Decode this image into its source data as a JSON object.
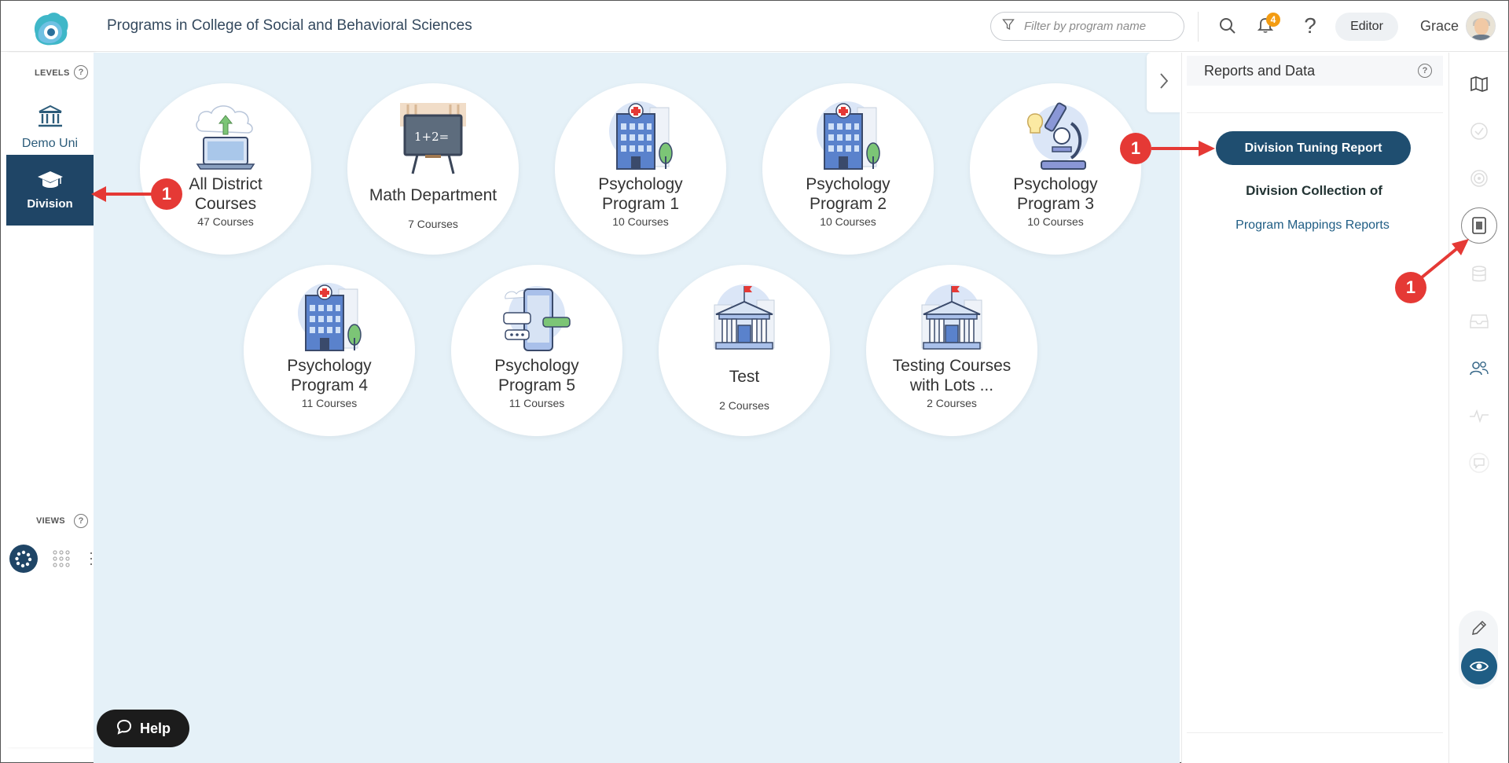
{
  "header": {
    "title": "Programs in College of Social and Behavioral Sciences",
    "filter_placeholder": "Filter by program name",
    "notification_count": "4",
    "help_label": "?",
    "editor_label": "Editor",
    "user_name": "Grace"
  },
  "sidebar": {
    "levels_label": "LEVELS",
    "levels": [
      {
        "label": "Demo Uni",
        "icon": "institution-icon",
        "active": false
      },
      {
        "label": "Division",
        "icon": "graduation-cap-icon",
        "active": true
      }
    ],
    "views_label": "VIEWS",
    "views": [
      {
        "icon": "bubble-view-icon",
        "active": true
      },
      {
        "icon": "grid-view-icon",
        "active": false
      },
      {
        "icon": "list-view-icon",
        "active": false
      }
    ],
    "help_q": "?"
  },
  "programs": [
    {
      "name": "All District Courses",
      "count": "47 Courses",
      "icon": "cloud-upload-laptop-icon"
    },
    {
      "name": "Math Department",
      "count": "7 Courses",
      "icon": "chalkboard-icon"
    },
    {
      "name": "Psychology Program 1",
      "count": "10 Courses",
      "icon": "hospital-icon"
    },
    {
      "name": "Psychology Program 2",
      "count": "10 Courses",
      "icon": "hospital-icon"
    },
    {
      "name": "Psychology Program 3",
      "count": "10 Courses",
      "icon": "microscope-icon"
    },
    {
      "name": "Psychology Program 4",
      "count": "11 Courses",
      "icon": "hospital-icon"
    },
    {
      "name": "Psychology Program 5",
      "count": "11 Courses",
      "icon": "phone-chat-icon"
    },
    {
      "name": "Test",
      "count": "2 Courses",
      "icon": "building-icon"
    },
    {
      "name": "Testing Courses with Lots ...",
      "count": "2 Courses",
      "icon": "building-icon"
    }
  ],
  "math_board_text": "1+2=",
  "help_button": {
    "label": "Help"
  },
  "reports_panel": {
    "title": "Reports and Data",
    "tuning_button": "Division Tuning Report",
    "collection_label": "Division Collection of",
    "mapping_link": "Program Mappings Reports"
  },
  "rail_icons": [
    "map-icon",
    "check-circle-icon",
    "target-icon",
    "report-icon",
    "database-icon",
    "inbox-icon",
    "users-icon",
    "pulse-icon",
    "comment-icon",
    "pencil-icon",
    "eye-icon"
  ],
  "annotations": {
    "marker_label": "1"
  },
  "colors": {
    "navy": "#1f4566",
    "button_blue": "#1f4e70",
    "link_blue": "#1f5d84",
    "badge_orange": "#f39c12",
    "marker_red": "#e53935",
    "canvas_bg": "#e5f1f8"
  }
}
